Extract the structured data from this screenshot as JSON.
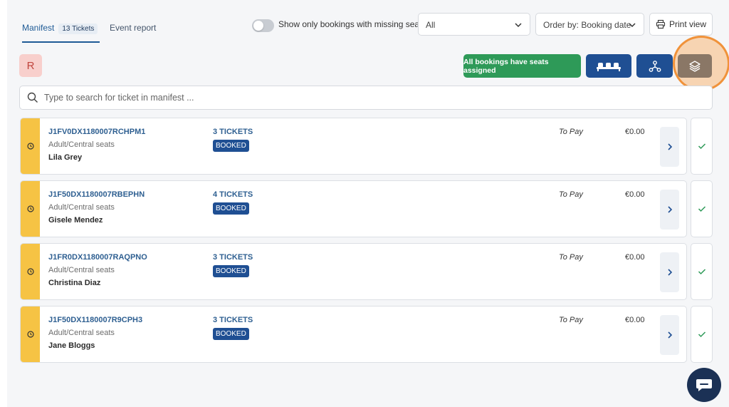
{
  "tabs": {
    "manifest_label": "Manifest",
    "manifest_count": "13 Tickets",
    "event_report_label": "Event report"
  },
  "filters": {
    "missing_seats_toggle_label": "Show only bookings with missing seats",
    "missing_seats_toggle_on": false,
    "status_select_value": "All",
    "order_select_value": "Order by: Booking date",
    "print_label": "Print view"
  },
  "user": {
    "avatar_initial": "R"
  },
  "actions": {
    "seat_status": "All bookings have seats assigned",
    "seats_icon": "seats-icon",
    "network_icon": "network-icon",
    "layers_icon": "layers-icon"
  },
  "search": {
    "placeholder": "Type to search for ticket in manifest ..."
  },
  "bookings": [
    {
      "ref": "J1FV0DX1180007RCHPM1",
      "type": "Adult/Central seats",
      "name": "Lila Grey",
      "tickets": "3 TICKETS",
      "status": "BOOKED",
      "pay_label": "To Pay",
      "amount": "€0.00"
    },
    {
      "ref": "J1F50DX1180007RBEPHN",
      "type": "Adult/Central seats",
      "name": "Gisele Mendez",
      "tickets": "4 TICKETS",
      "status": "BOOKED",
      "pay_label": "To Pay",
      "amount": "€0.00"
    },
    {
      "ref": "J1FR0DX1180007RAQPNO",
      "type": "Adult/Central seats",
      "name": "Christina Diaz",
      "tickets": "3 TICKETS",
      "status": "BOOKED",
      "pay_label": "To Pay",
      "amount": "€0.00"
    },
    {
      "ref": "J1F50DX1180007R9CPH3",
      "type": "Adult/Central seats",
      "name": "Jane Bloggs",
      "tickets": "3 TICKETS",
      "status": "BOOKED",
      "pay_label": "To Pay",
      "amount": "€0.00"
    }
  ],
  "colors": {
    "accent": "#1f4f93",
    "success": "#2e9a58",
    "pending_stripe": "#f6c344",
    "highlight": "#f0923a"
  }
}
